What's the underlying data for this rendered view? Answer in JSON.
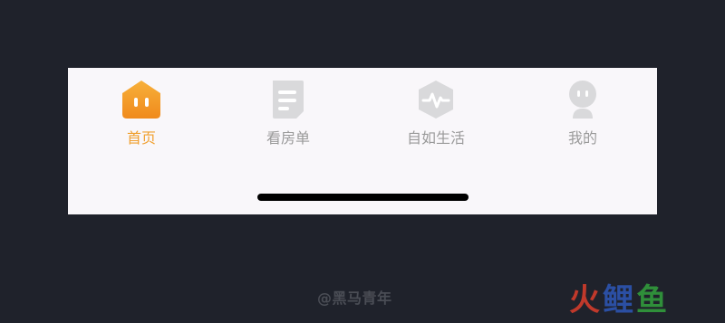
{
  "tabs": [
    {
      "label": "首页",
      "icon": "home-icon",
      "active": true
    },
    {
      "label": "看房单",
      "icon": "document-icon",
      "active": false
    },
    {
      "label": "自如生活",
      "icon": "pulse-icon",
      "active": false
    },
    {
      "label": "我的",
      "icon": "profile-icon",
      "active": false
    }
  ],
  "colors": {
    "active": "#f0a030",
    "inactive": "#9a9a9a",
    "icon_inactive": "#d9d9db",
    "tabbar_bg": "#f9f7fa",
    "page_bg": "#1f222b"
  },
  "watermark": "@黑马青年",
  "logo": {
    "char1": "火",
    "char2": "鲤",
    "char3": "鱼"
  }
}
